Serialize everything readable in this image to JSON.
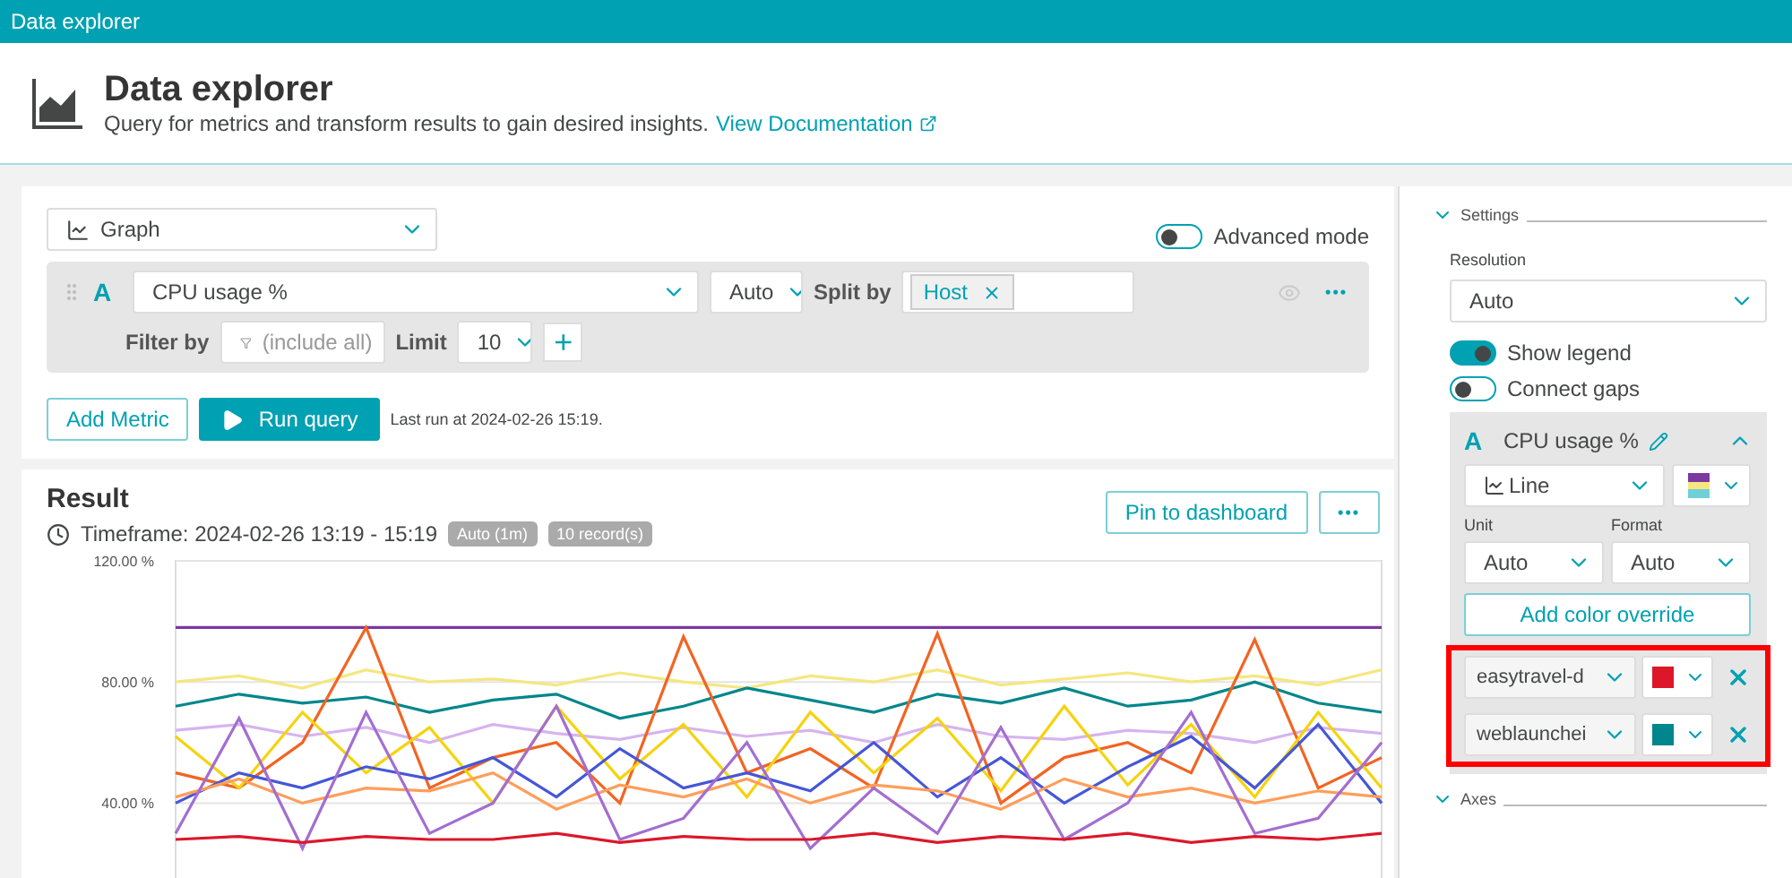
{
  "titlebar": {
    "title": "Data explorer"
  },
  "header": {
    "title": "Data explorer",
    "subtitle": "Query for metrics and transform results to gain desired insights.",
    "link": "View Documentation"
  },
  "visualization": {
    "value": "Graph"
  },
  "advanced_mode": {
    "label": "Advanced mode",
    "on": false
  },
  "query": {
    "letter": "A",
    "metric": "CPU usage %",
    "aggregation": "Auto",
    "split_label": "Split by",
    "split_tags": [
      "Host"
    ],
    "filter_label": "Filter by",
    "filter_placeholder": "(include all)",
    "limit_label": "Limit",
    "limit": "10",
    "add": "+",
    "more": "•••"
  },
  "actions": {
    "add_metric": "Add Metric",
    "run": "Run query",
    "last_run": "Last run at 2024-02-26 15:19."
  },
  "result": {
    "title": "Result",
    "timeframe": "Timeframe: 2024-02-26 13:19 - 15:19",
    "badges": [
      "Auto (1m)",
      "10 record(s)"
    ],
    "pin": "Pin to dashboard",
    "more": "•••",
    "chart_data": {
      "type": "line",
      "ylim": [
        0,
        120
      ],
      "yticks": [
        {
          "value": 40,
          "label": "40.00 %"
        },
        {
          "value": 80,
          "label": "80.00 %"
        },
        {
          "value": 120,
          "label": "120.00 %"
        }
      ],
      "series": [
        {
          "color": "#7c38a1",
          "values": [
            98,
            98,
            98,
            98,
            98,
            98,
            98,
            98,
            98,
            98,
            98,
            98,
            98,
            98,
            98,
            98,
            98,
            98,
            98,
            98
          ]
        },
        {
          "color": "#f5e680",
          "values": [
            80,
            82,
            78,
            84,
            80,
            81,
            79,
            83,
            80,
            78,
            82,
            80,
            84,
            79,
            81,
            83,
            80,
            82,
            79,
            84
          ]
        },
        {
          "color": "#00868c",
          "values": [
            72,
            76,
            73,
            75,
            70,
            74,
            76,
            68,
            72,
            78,
            74,
            70,
            76,
            73,
            78,
            72,
            74,
            80,
            73,
            70
          ]
        },
        {
          "color": "#d6b4ef",
          "values": [
            64,
            66,
            62,
            65,
            60,
            66,
            63,
            61,
            65,
            62,
            64,
            60,
            66,
            62,
            61,
            64,
            63,
            60,
            65,
            63
          ]
        },
        {
          "color": "#f26422",
          "values": [
            50,
            45,
            60,
            98,
            45,
            55,
            60,
            40,
            95,
            50,
            58,
            45,
            96,
            40,
            55,
            60,
            50,
            94,
            45,
            55
          ]
        },
        {
          "color": "#f5d30f",
          "values": [
            62,
            45,
            70,
            50,
            65,
            40,
            72,
            48,
            66,
            42,
            70,
            50,
            68,
            44,
            72,
            46,
            66,
            42,
            70,
            45
          ]
        },
        {
          "color": "#4556d7",
          "values": [
            40,
            50,
            45,
            52,
            48,
            55,
            42,
            58,
            45,
            50,
            44,
            60,
            42,
            55,
            40,
            52,
            62,
            45,
            66,
            40
          ]
        },
        {
          "color": "#ff9e5a",
          "values": [
            42,
            48,
            40,
            45,
            44,
            50,
            38,
            46,
            42,
            48,
            40,
            46,
            44,
            38,
            48,
            42,
            45,
            40,
            44,
            42
          ]
        },
        {
          "color": "#a36ed1",
          "values": [
            30,
            68,
            25,
            70,
            30,
            40,
            72,
            28,
            35,
            60,
            25,
            45,
            30,
            65,
            28,
            40,
            70,
            30,
            35,
            60
          ]
        },
        {
          "color": "#dc172a",
          "values": [
            28,
            29,
            27,
            29,
            28,
            28,
            30,
            27,
            29,
            28,
            28,
            30,
            27,
            29,
            28,
            30,
            27,
            29,
            28,
            30
          ]
        }
      ]
    }
  },
  "settings": {
    "title": "Settings",
    "expanded": true,
    "resolution_label": "Resolution",
    "resolution": "Auto",
    "toggles": [
      {
        "label": "Show legend",
        "on": true
      },
      {
        "label": "Connect gaps",
        "on": false
      }
    ],
    "metric": {
      "letter": "A",
      "name": "CPU usage %",
      "expanded": true,
      "chart_type": "Line",
      "unit_label": "Unit",
      "unit": "Auto",
      "format_label": "Format",
      "format": "Auto",
      "add_override": "Add color override",
      "overrides": [
        {
          "name": "easytravel-d",
          "color": "#dc172a"
        },
        {
          "name": "weblaunchei",
          "color": "#00868c"
        }
      ]
    },
    "axes": {
      "title": "Axes",
      "expanded": true
    }
  }
}
